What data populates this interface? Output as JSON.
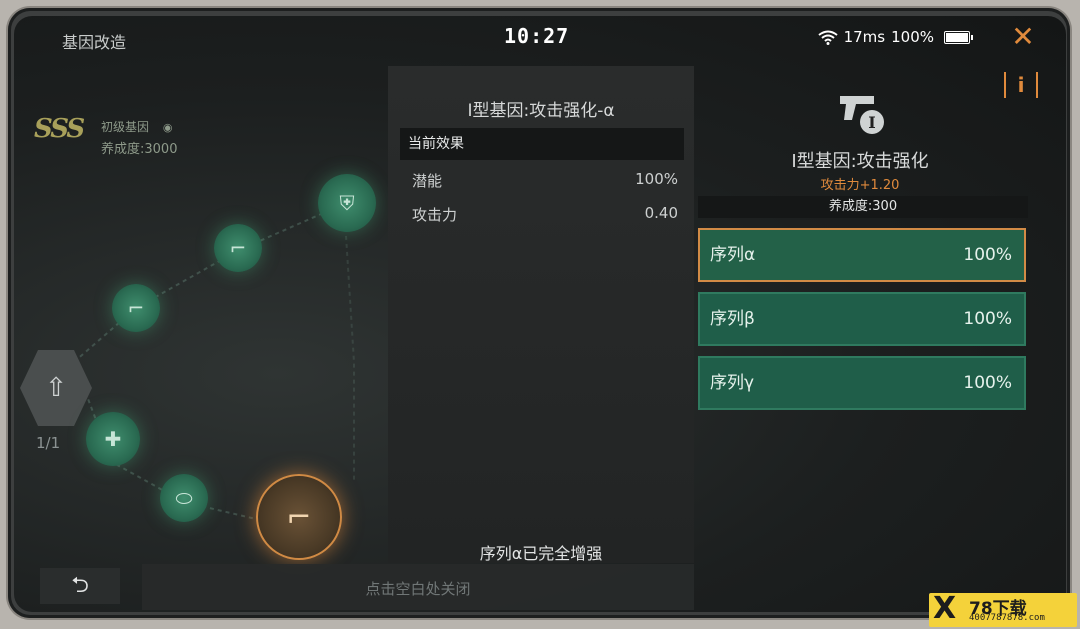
{
  "header": {
    "title": "基因改造",
    "clock": "10:27",
    "latency": "17ms",
    "battery": "100%",
    "close_glyph": "✕"
  },
  "tree": {
    "rank": "SSS",
    "gene_level": "初级基因",
    "gene_progress": "养成度:3000",
    "hex_count": "1/1",
    "nodes": [
      {
        "icon": "body-armor-icon"
      },
      {
        "icon": "rifle-icon"
      },
      {
        "icon": "rifle-icon"
      },
      {
        "icon": "medkit-icon"
      },
      {
        "icon": "pills-icon"
      },
      {
        "icon": "pistol-icon",
        "active": true
      }
    ]
  },
  "middle": {
    "title": "I型基因:攻击强化-α",
    "effect_header": "当前效果",
    "effects": [
      {
        "label": "潜能",
        "value": "100%"
      },
      {
        "label": "攻击力",
        "value": "0.40"
      }
    ],
    "footer": "序列α已完全增强"
  },
  "right": {
    "info_label": "i",
    "title": "I型基因:攻击强化",
    "bonus": "攻击力+1.20",
    "progress": "养成度:300",
    "sequences": [
      {
        "label": "序列α",
        "value": "100%",
        "selected": true
      },
      {
        "label": "序列β",
        "value": "100%"
      },
      {
        "label": "序列γ",
        "value": "100%"
      }
    ]
  },
  "bottom": {
    "back_glyph": "⮌",
    "close_hint": "点击空白处关闭"
  },
  "watermark": {
    "mark": "X",
    "brand": "78下载",
    "url": "4007787878.com"
  },
  "colors": {
    "accent": "#e08a3c",
    "sequence_bg": "#1f5e49",
    "node_green": "#3f8d6d"
  }
}
